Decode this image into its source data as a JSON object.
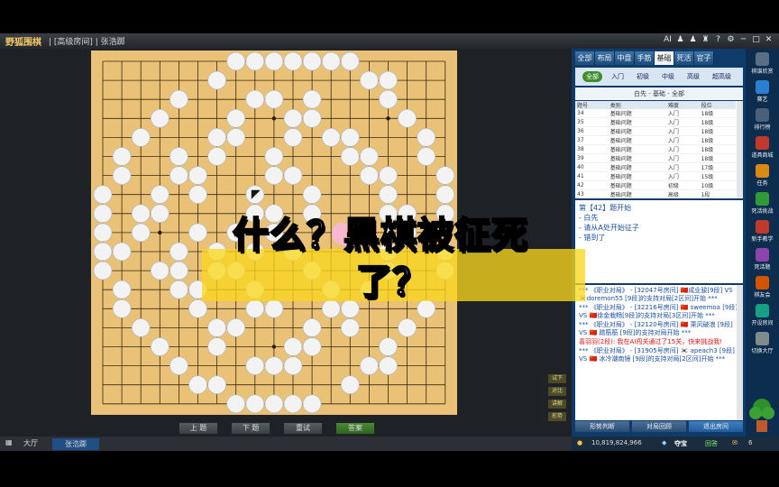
{
  "app": {
    "logo": "野狐围棋",
    "crumb": "| [高级房间] | 张浩踯",
    "window_icons": [
      "AI",
      "♟",
      "♟",
      "♜",
      "?",
      "⚙",
      "─",
      "□",
      "✕"
    ]
  },
  "board": {
    "white": [
      [
        7,
        0
      ],
      [
        8,
        0
      ],
      [
        9,
        0
      ],
      [
        10,
        0
      ],
      [
        11,
        0
      ],
      [
        12,
        0
      ],
      [
        13,
        0
      ],
      [
        6,
        1
      ],
      [
        14,
        1
      ],
      [
        15,
        1
      ],
      [
        4,
        2
      ],
      [
        8,
        2
      ],
      [
        9,
        2
      ],
      [
        11,
        2
      ],
      [
        15,
        2
      ],
      [
        3,
        3
      ],
      [
        7,
        3
      ],
      [
        10,
        3
      ],
      [
        11,
        3
      ],
      [
        16,
        3
      ],
      [
        2,
        4
      ],
      [
        6,
        4
      ],
      [
        7,
        4
      ],
      [
        10,
        4
      ],
      [
        12,
        4
      ],
      [
        13,
        4
      ],
      [
        17,
        4
      ],
      [
        1,
        5
      ],
      [
        4,
        5
      ],
      [
        6,
        5
      ],
      [
        9,
        5
      ],
      [
        13,
        5
      ],
      [
        14,
        5
      ],
      [
        17,
        5
      ],
      [
        1,
        6
      ],
      [
        4,
        6
      ],
      [
        5,
        6
      ],
      [
        9,
        6
      ],
      [
        10,
        6
      ],
      [
        14,
        6
      ],
      [
        15,
        6
      ],
      [
        18,
        6
      ],
      [
        0,
        7
      ],
      [
        3,
        7
      ],
      [
        5,
        7
      ],
      [
        8,
        7
      ],
      [
        11,
        7
      ],
      [
        15,
        7
      ],
      [
        18,
        7
      ],
      [
        0,
        8
      ],
      [
        2,
        8
      ],
      [
        3,
        8
      ],
      [
        8,
        8
      ],
      [
        9,
        8
      ],
      [
        11,
        8
      ],
      [
        15,
        8
      ],
      [
        16,
        8
      ],
      [
        18,
        8
      ],
      [
        0,
        9
      ],
      [
        2,
        9
      ],
      [
        5,
        9
      ],
      [
        7,
        9
      ],
      [
        9,
        9
      ],
      [
        16,
        9
      ],
      [
        0,
        10
      ],
      [
        1,
        10
      ],
      [
        4,
        10
      ],
      [
        6,
        10
      ],
      [
        8,
        10
      ],
      [
        10,
        10
      ],
      [
        15,
        10
      ],
      [
        18,
        10
      ],
      [
        0,
        11
      ],
      [
        3,
        11
      ],
      [
        4,
        11
      ],
      [
        6,
        11
      ],
      [
        7,
        11
      ],
      [
        11,
        11
      ],
      [
        15,
        11
      ],
      [
        18,
        11
      ],
      [
        1,
        12
      ],
      [
        4,
        12
      ],
      [
        5,
        12
      ],
      [
        8,
        12
      ],
      [
        12,
        12
      ],
      [
        14,
        12
      ],
      [
        1,
        13
      ],
      [
        5,
        13
      ],
      [
        8,
        13
      ],
      [
        9,
        13
      ],
      [
        12,
        13
      ],
      [
        13,
        13
      ],
      [
        17,
        13
      ],
      [
        2,
        14
      ],
      [
        6,
        14
      ],
      [
        7,
        14
      ],
      [
        11,
        14
      ],
      [
        13,
        14
      ],
      [
        16,
        14
      ],
      [
        3,
        15
      ],
      [
        6,
        15
      ],
      [
        10,
        15
      ],
      [
        11,
        15
      ],
      [
        15,
        15
      ],
      [
        4,
        16
      ],
      [
        8,
        16
      ],
      [
        9,
        16
      ],
      [
        10,
        16
      ],
      [
        14,
        16
      ],
      [
        15,
        16
      ],
      [
        5,
        17
      ],
      [
        6,
        17
      ],
      [
        13,
        17
      ],
      [
        7,
        18
      ],
      [
        8,
        18
      ],
      [
        9,
        18
      ],
      [
        10,
        18
      ],
      [
        11,
        18
      ]
    ],
    "black_last": [
      8,
      7
    ],
    "hoshi": [
      [
        3,
        3
      ],
      [
        9,
        3
      ],
      [
        15,
        3
      ],
      [
        3,
        9
      ],
      [
        9,
        9
      ],
      [
        15,
        9
      ],
      [
        3,
        15
      ],
      [
        9,
        15
      ],
      [
        15,
        15
      ]
    ]
  },
  "controls": {
    "prev": "上  题",
    "next": "下  题",
    "retry": "重试",
    "answer": "答案"
  },
  "side_mini": [
    "试下",
    "对比",
    "讲解",
    "形势"
  ],
  "taskbar": {
    "hall": "大厅",
    "active": "张浩踯"
  },
  "tabs": [
    "全部",
    "布局",
    "中盘",
    "手筋",
    "基础",
    "死活",
    "官子"
  ],
  "tab_active": "基础",
  "levels": [
    "全部",
    "入门",
    "初级",
    "中级",
    "高级",
    "超高级"
  ],
  "level_active": "全部",
  "filter_line": "白先 - 基础 - 全部",
  "table": {
    "headers": [
      "题号",
      "类别",
      "难度",
      "段位"
    ],
    "rows": [
      [
        "34",
        "基础问题",
        "入门",
        "18级"
      ],
      [
        "35",
        "基础问题",
        "入门",
        "18级"
      ],
      [
        "36",
        "基础问题",
        "入门",
        "18级"
      ],
      [
        "37",
        "基础问题",
        "入门",
        "18级"
      ],
      [
        "38",
        "基础问题",
        "入门",
        "18级"
      ],
      [
        "39",
        "基础问题",
        "入门",
        "18级"
      ],
      [
        "40",
        "基础问题",
        "入门",
        "17级"
      ],
      [
        "41",
        "基础问题",
        "入门",
        "15级"
      ],
      [
        "42",
        "基础问题",
        "初级",
        "10级"
      ],
      [
        "43",
        "基础问题",
        "高级",
        "1段"
      ],
      [
        "45",
        "基础问题",
        "中级",
        "3级"
      ]
    ]
  },
  "msg": {
    "title": "第【42】题开始",
    "l1": "- 白先",
    "l2": "- 请从A处开始征子",
    "l3": "- 错到了"
  },
  "chat": [
    {
      "t": "*** 《职业对局》 - [32047号房间] 🇨🇳成业骏[9段] VS 🇰🇷doremon55 [9段]的支持对局[2区间]开始 ***"
    },
    {
      "t": "*** 《职业对局》 - [32216号房间] 🇨🇳 sweemoa [9段] VS 🇨🇳徐金栽畅[9段]的支持对局[3区间]开始 ***"
    },
    {
      "t": "*** 《职业对局》 - [32120号房间] 🇨🇳 栗风破浪 [9段] VS 🇨🇳 蹭筋筋 [9段]的支持对局开始 ***"
    },
    {
      "t": "喜羽羽(2段): 我在AI闯关通过了15关，快来挑战我!",
      "red": true
    },
    {
      "t": "*** 《职业对局》 - [31905号房间] 🇰🇷 apeach3 [9段] VS 🇨🇳 冰冷潮南镜 [9段]的支持对局[2区间]开始 ***"
    }
  ],
  "bottom_btns": [
    "形势判断",
    "对局回顾",
    "退出房间"
  ],
  "status": {
    "coins": "10,819,824,966",
    "treasure": "夺宝",
    "back": "回答",
    "num": "6"
  },
  "far_items": [
    "棋谱欣赏",
    "赛艺",
    "排行榜",
    "道具商城",
    "任务",
    "死活挑战",
    "新手教学",
    "死活题",
    "棋友会",
    "开设房间",
    "切换大厅"
  ],
  "overlay": {
    "line1": "什么？黑棋被征死",
    "line2": "了？"
  },
  "colors": {
    "board": "#e9c177",
    "accent": "#3f8e2e",
    "panel": "#0e3b6a"
  }
}
